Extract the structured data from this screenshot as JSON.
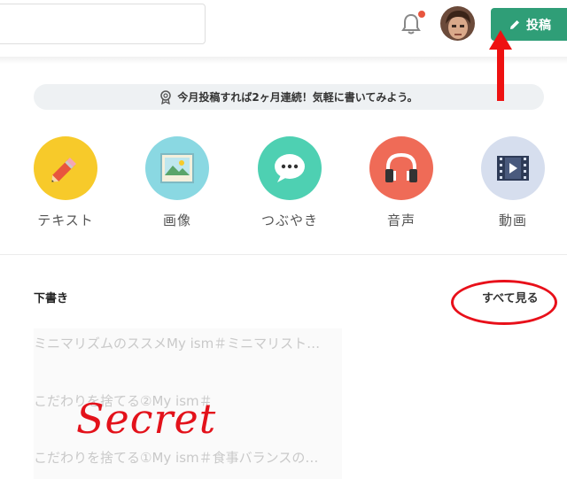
{
  "header": {
    "post_button_label": "投稿"
  },
  "tip": {
    "text": "今月投稿すれば2ヶ月連続！気軽に書いてみよう。"
  },
  "post_types": [
    {
      "label": "テキスト",
      "color": "#f7ca2a",
      "icon": "pencil-icon"
    },
    {
      "label": "画像",
      "color": "#8ad8e2",
      "icon": "image-icon"
    },
    {
      "label": "つぶやき",
      "color": "#4ed0b2",
      "icon": "speech-bubble-icon"
    },
    {
      "label": "音声",
      "color": "#ef6b57",
      "icon": "headphones-icon"
    },
    {
      "label": "動画",
      "color": "#d6deee",
      "icon": "film-icon"
    }
  ],
  "drafts": {
    "title": "下書き",
    "see_all_label": "すべて見る",
    "items": [
      "ミニマリズムのススメMy ism＃ミニマリスト…",
      "こだわりを捨てる②My ism＃",
      "こだわりを捨てる①My ism＃食事バランスの…"
    ]
  },
  "annotation": {
    "text": "Secret"
  },
  "colors": {
    "accent": "#2f9e77",
    "annotation_red": "#e3121b"
  }
}
